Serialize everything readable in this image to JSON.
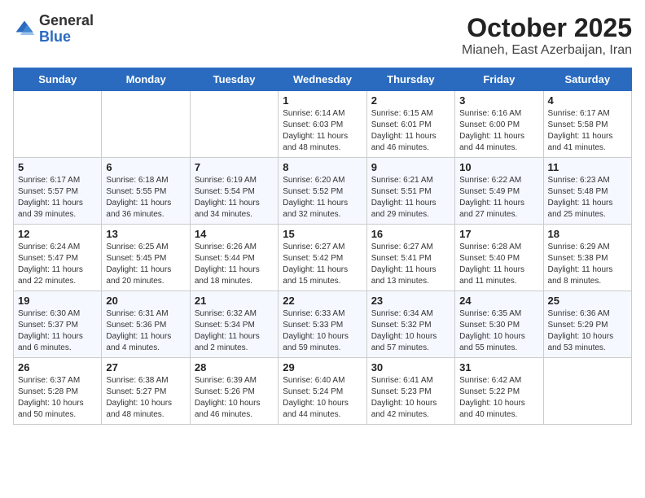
{
  "logo": {
    "general": "General",
    "blue": "Blue"
  },
  "header": {
    "month": "October 2025",
    "location": "Mianeh, East Azerbaijan, Iran"
  },
  "weekdays": [
    "Sunday",
    "Monday",
    "Tuesday",
    "Wednesday",
    "Thursday",
    "Friday",
    "Saturday"
  ],
  "weeks": [
    [
      {
        "day": "",
        "info": ""
      },
      {
        "day": "",
        "info": ""
      },
      {
        "day": "",
        "info": ""
      },
      {
        "day": "1",
        "info": "Sunrise: 6:14 AM\nSunset: 6:03 PM\nDaylight: 11 hours and 48 minutes."
      },
      {
        "day": "2",
        "info": "Sunrise: 6:15 AM\nSunset: 6:01 PM\nDaylight: 11 hours and 46 minutes."
      },
      {
        "day": "3",
        "info": "Sunrise: 6:16 AM\nSunset: 6:00 PM\nDaylight: 11 hours and 44 minutes."
      },
      {
        "day": "4",
        "info": "Sunrise: 6:17 AM\nSunset: 5:58 PM\nDaylight: 11 hours and 41 minutes."
      }
    ],
    [
      {
        "day": "5",
        "info": "Sunrise: 6:17 AM\nSunset: 5:57 PM\nDaylight: 11 hours and 39 minutes."
      },
      {
        "day": "6",
        "info": "Sunrise: 6:18 AM\nSunset: 5:55 PM\nDaylight: 11 hours and 36 minutes."
      },
      {
        "day": "7",
        "info": "Sunrise: 6:19 AM\nSunset: 5:54 PM\nDaylight: 11 hours and 34 minutes."
      },
      {
        "day": "8",
        "info": "Sunrise: 6:20 AM\nSunset: 5:52 PM\nDaylight: 11 hours and 32 minutes."
      },
      {
        "day": "9",
        "info": "Sunrise: 6:21 AM\nSunset: 5:51 PM\nDaylight: 11 hours and 29 minutes."
      },
      {
        "day": "10",
        "info": "Sunrise: 6:22 AM\nSunset: 5:49 PM\nDaylight: 11 hours and 27 minutes."
      },
      {
        "day": "11",
        "info": "Sunrise: 6:23 AM\nSunset: 5:48 PM\nDaylight: 11 hours and 25 minutes."
      }
    ],
    [
      {
        "day": "12",
        "info": "Sunrise: 6:24 AM\nSunset: 5:47 PM\nDaylight: 11 hours and 22 minutes."
      },
      {
        "day": "13",
        "info": "Sunrise: 6:25 AM\nSunset: 5:45 PM\nDaylight: 11 hours and 20 minutes."
      },
      {
        "day": "14",
        "info": "Sunrise: 6:26 AM\nSunset: 5:44 PM\nDaylight: 11 hours and 18 minutes."
      },
      {
        "day": "15",
        "info": "Sunrise: 6:27 AM\nSunset: 5:42 PM\nDaylight: 11 hours and 15 minutes."
      },
      {
        "day": "16",
        "info": "Sunrise: 6:27 AM\nSunset: 5:41 PM\nDaylight: 11 hours and 13 minutes."
      },
      {
        "day": "17",
        "info": "Sunrise: 6:28 AM\nSunset: 5:40 PM\nDaylight: 11 hours and 11 minutes."
      },
      {
        "day": "18",
        "info": "Sunrise: 6:29 AM\nSunset: 5:38 PM\nDaylight: 11 hours and 8 minutes."
      }
    ],
    [
      {
        "day": "19",
        "info": "Sunrise: 6:30 AM\nSunset: 5:37 PM\nDaylight: 11 hours and 6 minutes."
      },
      {
        "day": "20",
        "info": "Sunrise: 6:31 AM\nSunset: 5:36 PM\nDaylight: 11 hours and 4 minutes."
      },
      {
        "day": "21",
        "info": "Sunrise: 6:32 AM\nSunset: 5:34 PM\nDaylight: 11 hours and 2 minutes."
      },
      {
        "day": "22",
        "info": "Sunrise: 6:33 AM\nSunset: 5:33 PM\nDaylight: 10 hours and 59 minutes."
      },
      {
        "day": "23",
        "info": "Sunrise: 6:34 AM\nSunset: 5:32 PM\nDaylight: 10 hours and 57 minutes."
      },
      {
        "day": "24",
        "info": "Sunrise: 6:35 AM\nSunset: 5:30 PM\nDaylight: 10 hours and 55 minutes."
      },
      {
        "day": "25",
        "info": "Sunrise: 6:36 AM\nSunset: 5:29 PM\nDaylight: 10 hours and 53 minutes."
      }
    ],
    [
      {
        "day": "26",
        "info": "Sunrise: 6:37 AM\nSunset: 5:28 PM\nDaylight: 10 hours and 50 minutes."
      },
      {
        "day": "27",
        "info": "Sunrise: 6:38 AM\nSunset: 5:27 PM\nDaylight: 10 hours and 48 minutes."
      },
      {
        "day": "28",
        "info": "Sunrise: 6:39 AM\nSunset: 5:26 PM\nDaylight: 10 hours and 46 minutes."
      },
      {
        "day": "29",
        "info": "Sunrise: 6:40 AM\nSunset: 5:24 PM\nDaylight: 10 hours and 44 minutes."
      },
      {
        "day": "30",
        "info": "Sunrise: 6:41 AM\nSunset: 5:23 PM\nDaylight: 10 hours and 42 minutes."
      },
      {
        "day": "31",
        "info": "Sunrise: 6:42 AM\nSunset: 5:22 PM\nDaylight: 10 hours and 40 minutes."
      },
      {
        "day": "",
        "info": ""
      }
    ]
  ]
}
